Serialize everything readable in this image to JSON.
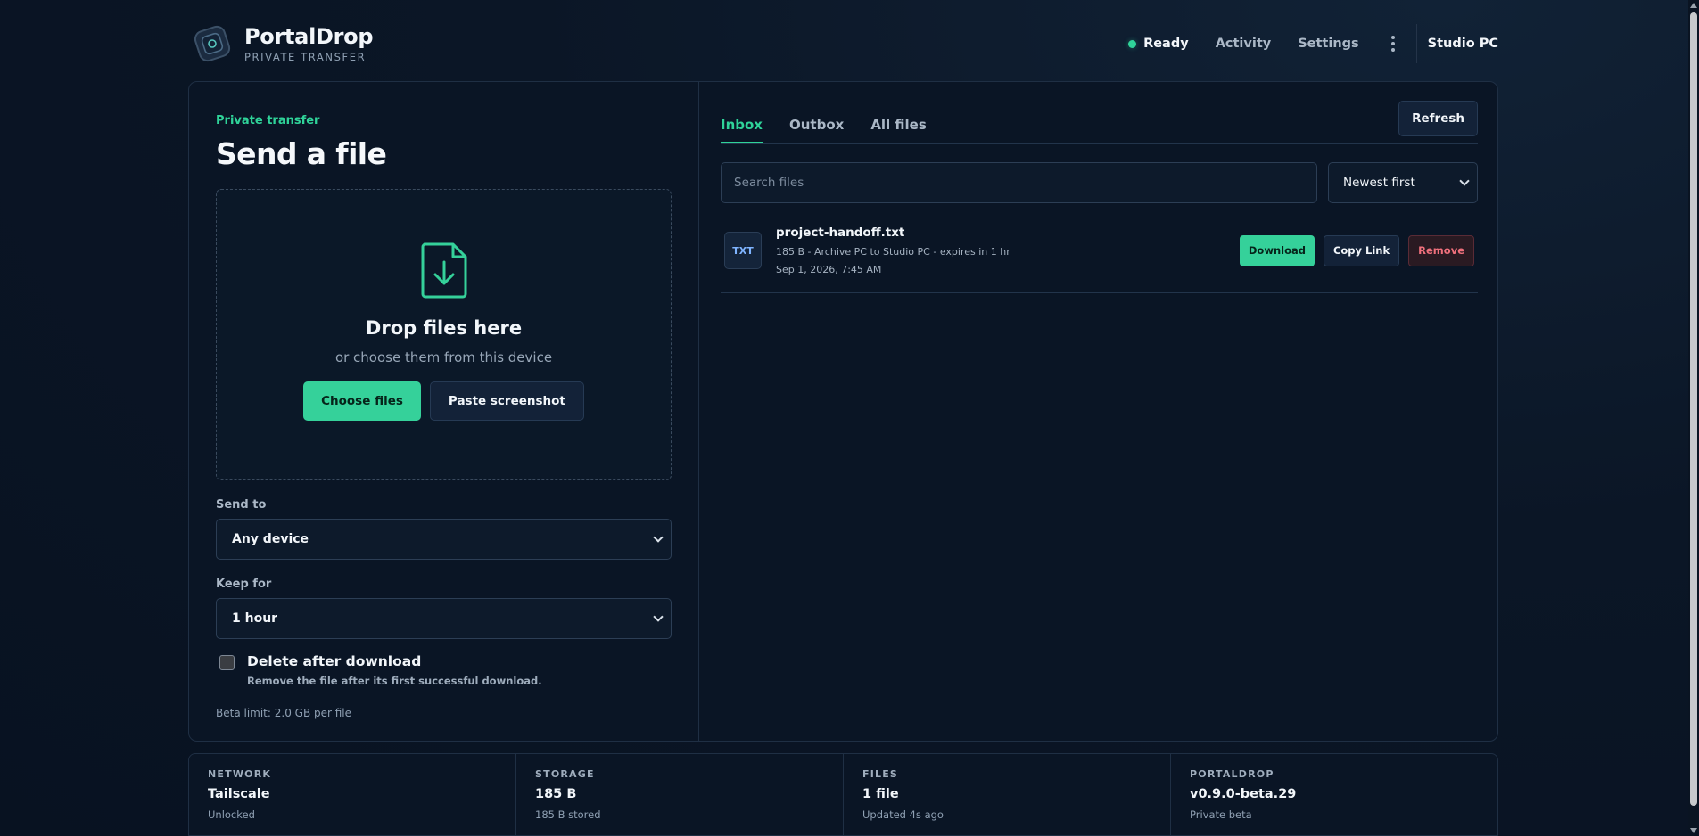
{
  "brand": {
    "name": "PortalDrop",
    "tagline": "PRIVATE TRANSFER"
  },
  "header": {
    "status_label": "Ready",
    "status_color": "#2fd399",
    "nav": [
      "Activity",
      "Settings"
    ],
    "more_icon": "kebab-menu-icon",
    "device_name": "Studio PC"
  },
  "send": {
    "eyebrow": "Private transfer",
    "title": "Send a file",
    "dropzone": {
      "icon": "download-file-icon",
      "title": "Drop files here",
      "subtitle": "or choose them from this device",
      "choose_label": "Choose files",
      "paste_label": "Paste screenshot"
    },
    "send_to": {
      "label": "Send to",
      "value": "Any device"
    },
    "keep_for": {
      "label": "Keep for",
      "value": "1 hour"
    },
    "delete_after": {
      "label": "Delete after download",
      "description": "Remove the file after its first successful download.",
      "checked": false
    },
    "limit_note": "Beta limit: 2.0 GB per file"
  },
  "files": {
    "tabs": [
      {
        "label": "Inbox",
        "active": true
      },
      {
        "label": "Outbox",
        "active": false
      },
      {
        "label": "All files",
        "active": false
      }
    ],
    "refresh_label": "Refresh",
    "search_placeholder": "Search files",
    "sort_value": "Newest first",
    "items": [
      {
        "type": "TXT",
        "name": "project-handoff.txt",
        "meta": "185 B - Archive PC to Studio PC - expires in 1 hr",
        "date": "Sep 1, 2026, 7:45 AM",
        "download_label": "Download",
        "copy_label": "Copy Link",
        "remove_label": "Remove"
      }
    ]
  },
  "stats": [
    {
      "key": "NETWORK",
      "value": "Tailscale",
      "sub": "Unlocked"
    },
    {
      "key": "STORAGE",
      "value": "185 B",
      "sub": "185 B stored"
    },
    {
      "key": "FILES",
      "value": "1 file",
      "sub": "Updated 4s ago"
    },
    {
      "key": "PORTALDROP",
      "value": "v0.9.0-beta.29",
      "sub": "Private beta"
    }
  ],
  "colors": {
    "accent": "#35d19a",
    "danger": "#f0707c",
    "background": "#0b1626"
  }
}
